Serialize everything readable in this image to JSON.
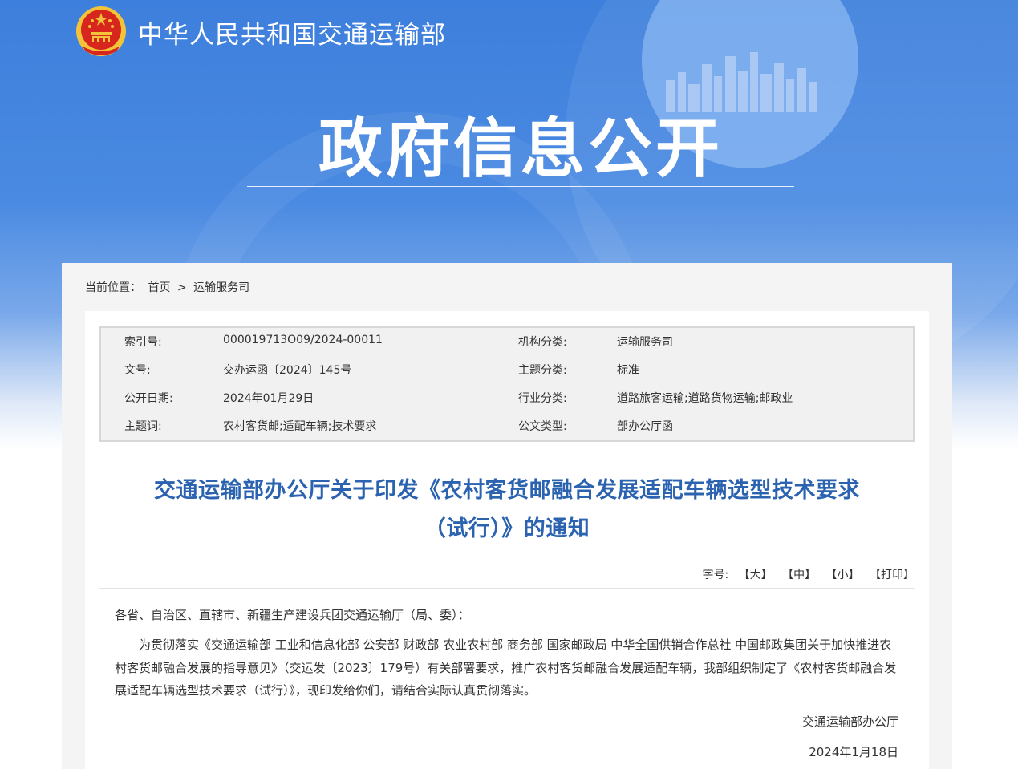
{
  "header": {
    "site_title": "中华人民共和国交通运输部",
    "section_title": "政府信息公开"
  },
  "breadcrumb": {
    "label": "当前位置：",
    "items": [
      "首页",
      "运输服务司"
    ],
    "separator": ">"
  },
  "meta": {
    "index_label": "索引号:",
    "index_value": "000019713O09/2024-00011",
    "org_label": "机构分类:",
    "org_value": "运输服务司",
    "docno_label": "文号:",
    "docno_value": "交办运函〔2024〕145号",
    "topic_label": "主题分类:",
    "topic_value": "标准",
    "date_label": "公开日期:",
    "date_value": "2024年01月29日",
    "industry_label": "行业分类:",
    "industry_value": "道路旅客运输;道路货物运输;邮政业",
    "keywords_label": "主题词:",
    "keywords_value": "农村客货邮;适配车辆;技术要求",
    "doctype_label": "公文类型:",
    "doctype_value": "部办公厅函"
  },
  "document": {
    "title_line1": "交通运输部办公厅关于印发《农村客货邮融合发展适配车辆选型技术要求",
    "title_line2": "（试行）》的通知",
    "salutation": "各省、自治区、直辖市、新疆生产建设兵团交通运输厅（局、委）：",
    "body": "为贯彻落实《交通运输部 工业和信息化部 公安部 财政部 农业农村部 商务部 国家邮政局 中华全国供销合作总社 中国邮政集团关于加快推进农村客货邮融合发展的指导意见》（交运发〔2023〕179号）有关部署要求，推广农村客货邮融合发展适配车辆，我部组织制定了《农村客货邮融合发展适配车辆选型技术要求（试行）》，现印发给你们，请结合实际认真贯彻落实。",
    "signer": "交通运输部办公厅",
    "sign_date": "2024年1月18日"
  },
  "font_size_bar": {
    "label": "字号:",
    "large": "【大】",
    "medium": "【中】",
    "small": "【小】",
    "print": "【打印】"
  },
  "colors": {
    "banner_blue": "#3d7fdc",
    "title_blue": "#2b63b0",
    "emblem_red": "#d7261e",
    "emblem_gold": "#f3c43a"
  }
}
